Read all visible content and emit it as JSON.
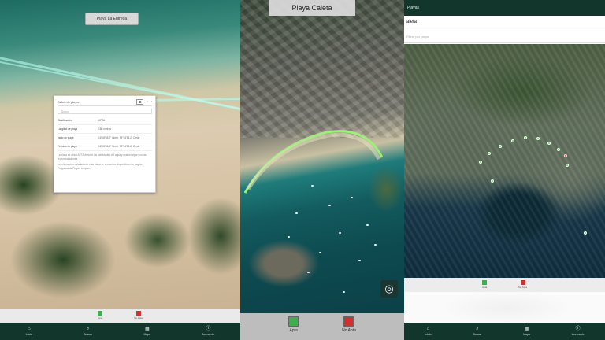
{
  "screen1": {
    "entrance_button": "Playa La Entrega",
    "popup": {
      "title": "Datos de playa",
      "search_placeholder": "Buscar",
      "rows": [
        {
          "key": "Clasificación",
          "value": "APTA"
        },
        {
          "key": "Longitud de playa",
          "value": "180 metros"
        },
        {
          "key": "Inicio de playa",
          "value": "16°49'55.2\" Norte, 99°54'55.2\" Oeste"
        },
        {
          "key": "Término de playa",
          "value": "16°49'56.4\" Norte, 99°54'54.6\" Oeste"
        }
      ],
      "note1": "La playa se ubica APTA durante las actividades del agua y está en vigor con las recomendaciones.",
      "note2": "La información detallada de esta playa se encuentra disponible en la página Programa de Playas Limpias."
    },
    "legend": [
      {
        "label": "Apta",
        "color": "#3cb04a"
      },
      {
        "label": "No Apta",
        "color": "#d32f2f"
      }
    ]
  },
  "screen2": {
    "title": "Playa Caleta",
    "legend": [
      {
        "label": "Apta",
        "color": "#3cb04a"
      },
      {
        "label": "No Apta",
        "color": "#d32f2f"
      }
    ]
  },
  "screen3": {
    "header": "Playas",
    "search_value": "aleta",
    "filter_placeholder": "Filtrar por playa",
    "legend": [
      {
        "label": "Apta",
        "color": "#3cb04a"
      },
      {
        "label": "No Apta",
        "color": "#d32f2f"
      }
    ]
  },
  "nav": [
    {
      "icon": "home-icon",
      "glyph": "⌂",
      "label": "Inicio"
    },
    {
      "icon": "search-icon",
      "glyph": "⌕",
      "label": "Buscar"
    },
    {
      "icon": "map-icon",
      "glyph": "▦",
      "label": "Mapa"
    },
    {
      "icon": "info-icon",
      "glyph": "ⓘ",
      "label": "Acerca de"
    }
  ],
  "colors": {
    "nav_bg": "#12362b",
    "apta": "#3cb04a",
    "no_apta": "#d32f2f"
  }
}
